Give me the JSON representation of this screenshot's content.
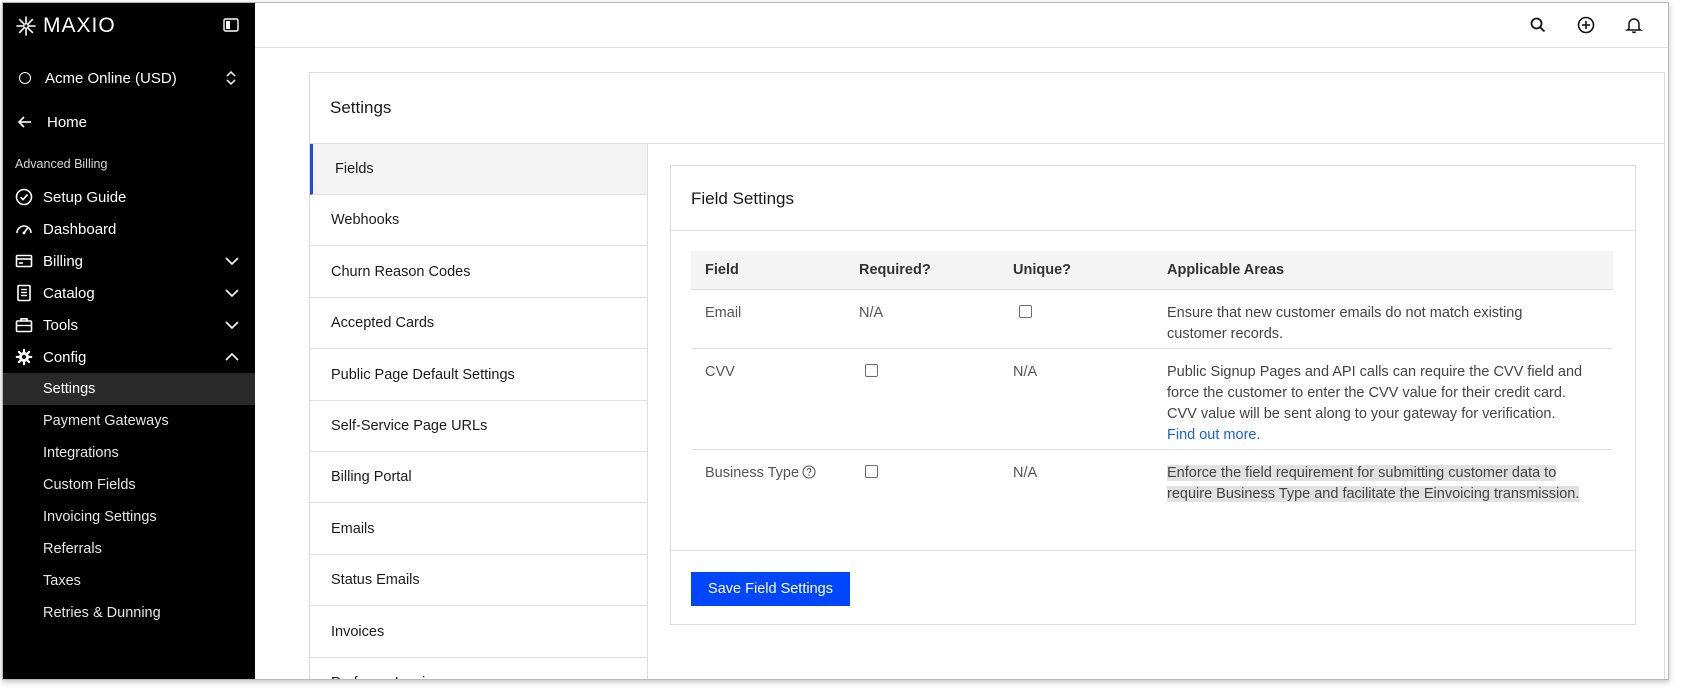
{
  "brand": {
    "logo_text": "MAXIO"
  },
  "account": {
    "name": "Acme Online (USD)"
  },
  "nav": {
    "home": "Home",
    "section_label": "Advanced Billing",
    "items": [
      {
        "label": "Setup Guide",
        "icon": "check-circle-icon"
      },
      {
        "label": "Dashboard",
        "icon": "gauge-icon"
      },
      {
        "label": "Billing",
        "icon": "card-icon",
        "expanded": false
      },
      {
        "label": "Catalog",
        "icon": "book-icon",
        "expanded": false
      },
      {
        "label": "Tools",
        "icon": "briefcase-icon",
        "expanded": false
      },
      {
        "label": "Config",
        "icon": "gear-icon",
        "expanded": true
      }
    ],
    "config_sub": [
      "Settings",
      "Payment Gateways",
      "Integrations",
      "Custom Fields",
      "Invoicing Settings",
      "Referrals",
      "Taxes",
      "Retries & Dunning"
    ]
  },
  "page": {
    "title": "Settings"
  },
  "settings_menu": [
    "Fields",
    "Webhooks",
    "Churn Reason Codes",
    "Accepted Cards",
    "Public Page Default Settings",
    "Self-Service Page URLs",
    "Billing Portal",
    "Emails",
    "Status Emails",
    "Invoices",
    "Proforma Invoices"
  ],
  "field_settings": {
    "title": "Field Settings",
    "headers": {
      "field": "Field",
      "required": "Required?",
      "unique": "Unique?",
      "areas": "Applicable Areas"
    },
    "rows": [
      {
        "field": "Email",
        "required": "N/A",
        "unique": "checkbox",
        "areas_1": "Ensure that new customer emails do not match existing",
        "areas_2": "customer records."
      },
      {
        "field": "CVV",
        "required": "checkbox",
        "unique": "N/A",
        "areas_1": "Public Signup Pages and API calls can require the CVV field and",
        "areas_2": "force the customer to enter the CVV value for their credit card.",
        "areas_3": "CVV value will be sent along to your gateway for verification.",
        "link": "Find out more."
      },
      {
        "field": "Business Type",
        "required": "checkbox",
        "unique": "N/A",
        "areas_1": "Enforce the field requirement for submitting customer data to",
        "areas_2": "require Business Type and facilitate the Einvoicing transmission."
      }
    ],
    "save_label": "Save Field Settings"
  },
  "colors": {
    "sidebar_bg": "#000000",
    "primary": "#0046ff",
    "link": "#1565d8",
    "active_indicator": "#1d4ed8"
  }
}
